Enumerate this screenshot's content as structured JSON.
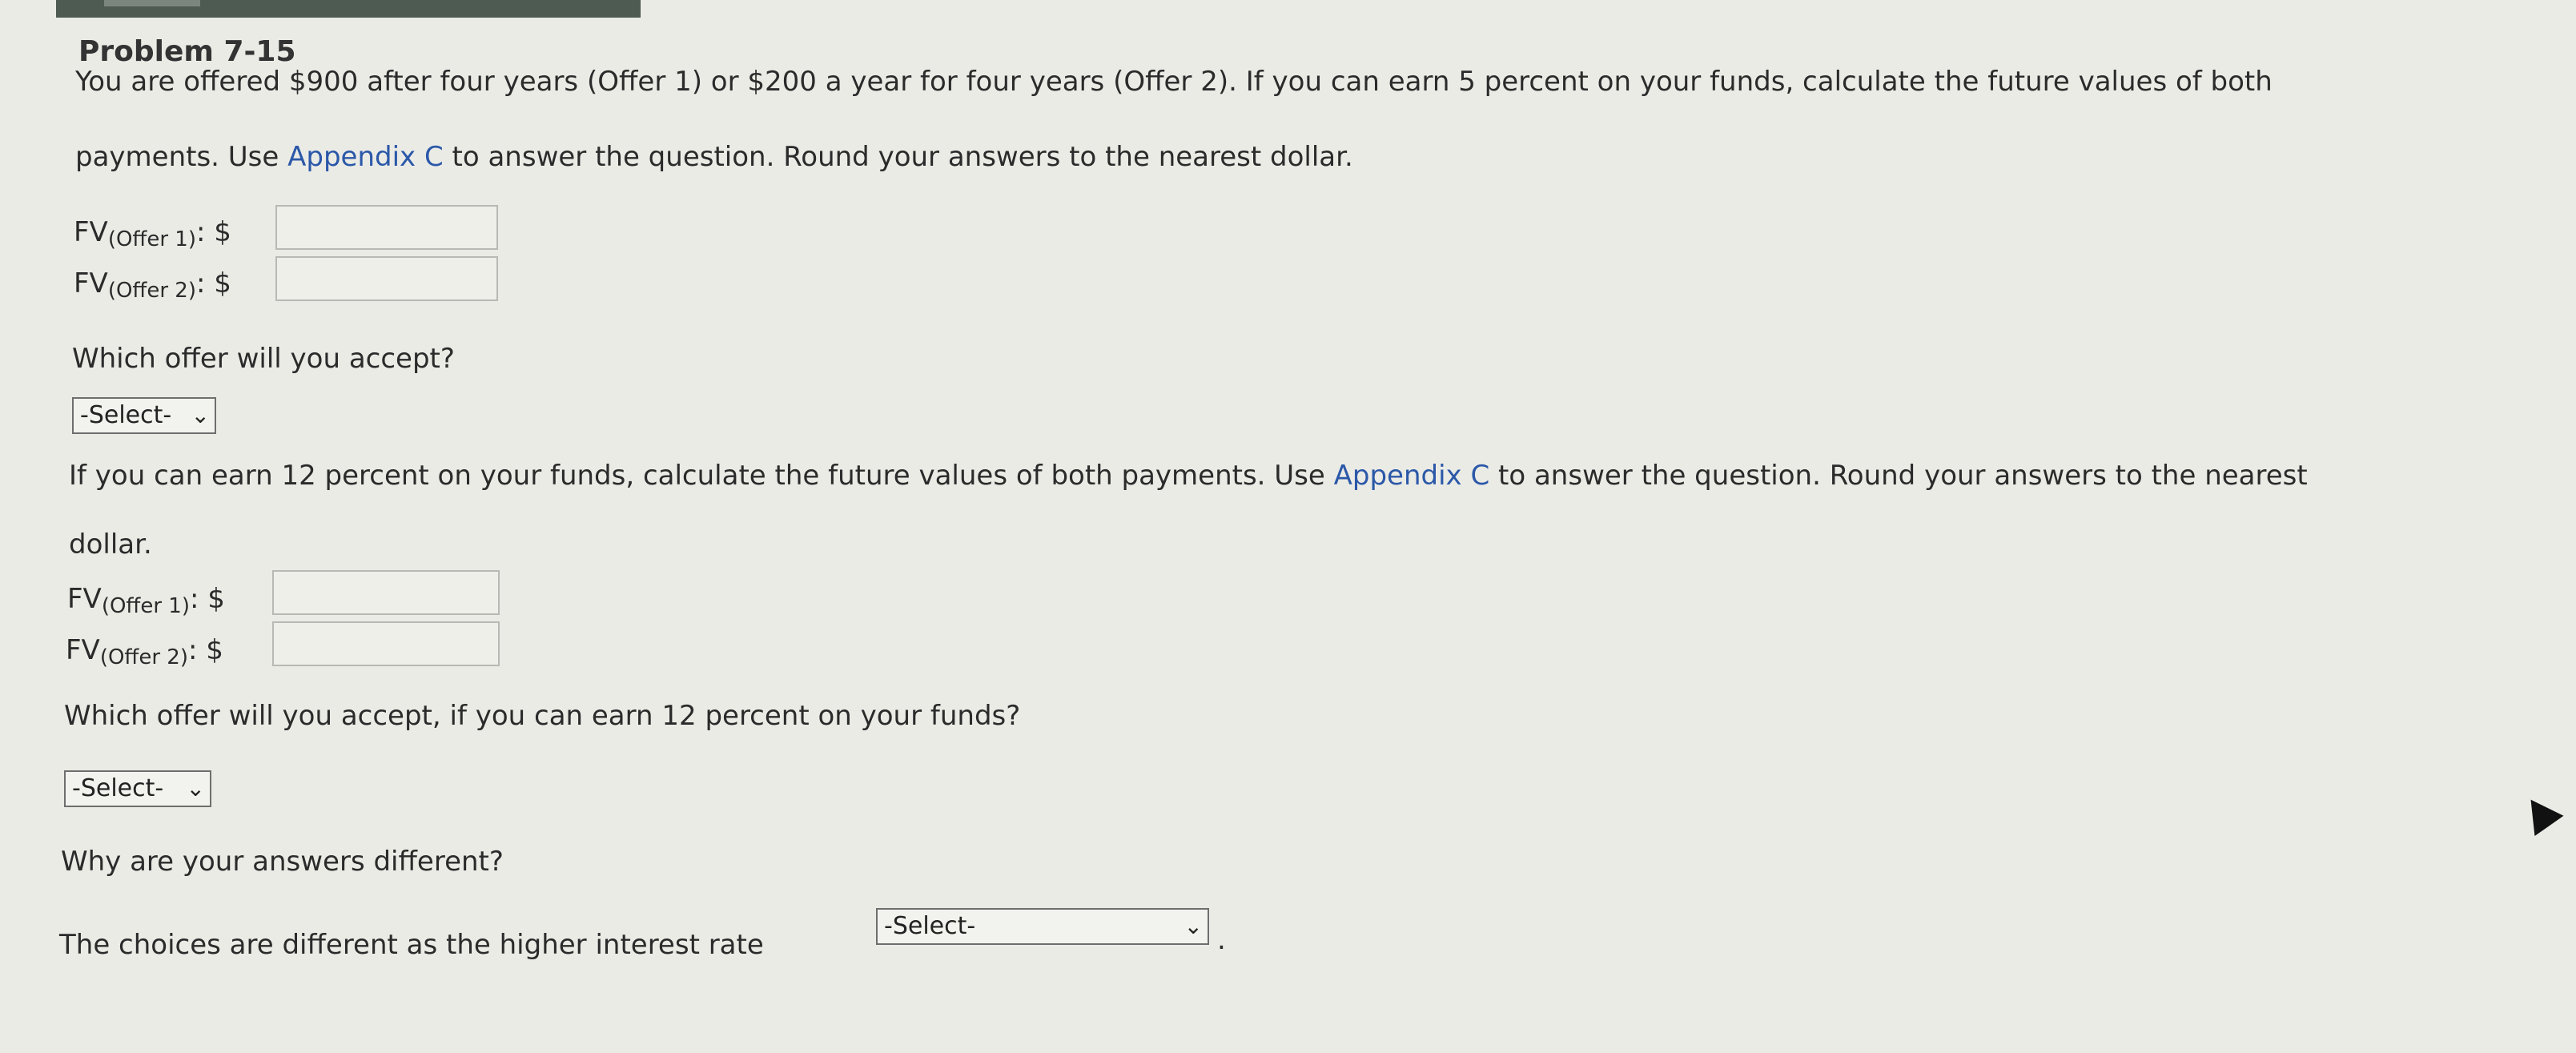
{
  "problem": {
    "title": "Problem 7-15"
  },
  "part1": {
    "intro_line1": "You are offered $900 after four years (Offer 1) or $200 a year for four years (Offer 2). If you can earn 5 percent on your funds, calculate the future values of both",
    "intro_line2_before_link": "payments. Use ",
    "link": "Appendix C",
    "intro_line2_after_link": " to answer the question. Round your answers to the nearest dollar.",
    "fv1_label_main": "FV",
    "fv1_label_sub": "(Offer 1)",
    "fv2_label_main": "FV",
    "fv2_label_sub": "(Offer 2)",
    "colon_dollar": ": $",
    "fv1_value": "",
    "fv2_value": "",
    "question": "Which offer will you accept?",
    "select_value": "-Select-"
  },
  "part2": {
    "intro_line1_before_link": "If you can earn 12 percent on your funds, calculate the future values of both payments. Use ",
    "link": "Appendix C",
    "intro_line1_after_link": " to answer the question. Round your answers to the nearest",
    "intro_line2": "dollar.",
    "fv1_label_main": "FV",
    "fv1_label_sub": "(Offer 1)",
    "fv2_label_main": "FV",
    "fv2_label_sub": "(Offer 2)",
    "colon_dollar": ": $",
    "fv1_value": "",
    "fv2_value": "",
    "question": "Which offer will you accept, if you can earn 12 percent on your funds?",
    "select_value": "-Select-"
  },
  "part3": {
    "question": "Why are your answers different?",
    "sentence_before": "The choices are different as the higher interest rate",
    "select_value": "-Select-",
    "sentence_after": "."
  }
}
